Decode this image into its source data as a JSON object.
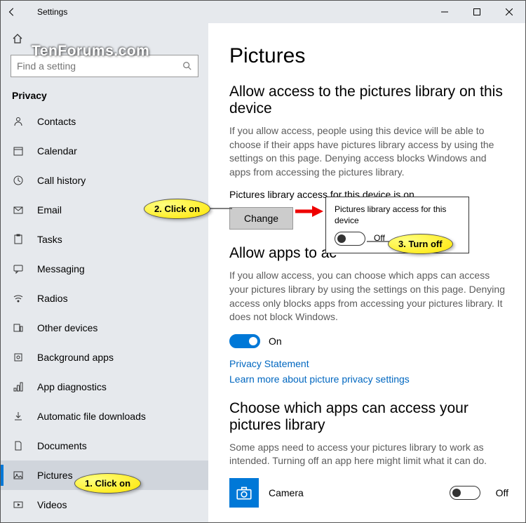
{
  "window": {
    "title": "Settings"
  },
  "watermark": "TenForums.com",
  "search": {
    "placeholder": "Find a setting"
  },
  "sidebar": {
    "section": "Privacy",
    "items": [
      {
        "label": "Contacts"
      },
      {
        "label": "Calendar"
      },
      {
        "label": "Call history"
      },
      {
        "label": "Email"
      },
      {
        "label": "Tasks"
      },
      {
        "label": "Messaging"
      },
      {
        "label": "Radios"
      },
      {
        "label": "Other devices"
      },
      {
        "label": "Background apps"
      },
      {
        "label": "App diagnostics"
      },
      {
        "label": "Automatic file downloads"
      },
      {
        "label": "Documents"
      },
      {
        "label": "Pictures"
      },
      {
        "label": "Videos"
      }
    ]
  },
  "page": {
    "title": "Pictures",
    "s1": {
      "heading": "Allow access to the pictures library on this device",
      "desc": "If you allow access, people using this device will be able to choose if their apps have pictures library access by using the settings on this page. Denying access blocks Windows and apps from accessing the pictures library.",
      "status": "Pictures library access for this device is on",
      "change": "Change"
    },
    "s2": {
      "heading_partial": "Allow apps to ac",
      "desc": "If you allow access, you can choose which apps can access your pictures library by using the settings on this page. Denying access only blocks apps from accessing your pictures library. It does not block Windows.",
      "toggle_label": "On",
      "link1": "Privacy Statement",
      "link2": "Learn more about picture privacy settings"
    },
    "s3": {
      "heading": "Choose which apps can access your pictures library",
      "desc": "Some apps need to access your pictures library to work as intended. Turning off an app here might limit what it can do.",
      "app": {
        "name": "Camera",
        "state": "Off"
      }
    }
  },
  "popup": {
    "label": "Pictures library access for this device",
    "state": "Off"
  },
  "annot": {
    "c1": "1. Click on",
    "c2": "2. Click on",
    "c3": "3. Turn off"
  }
}
